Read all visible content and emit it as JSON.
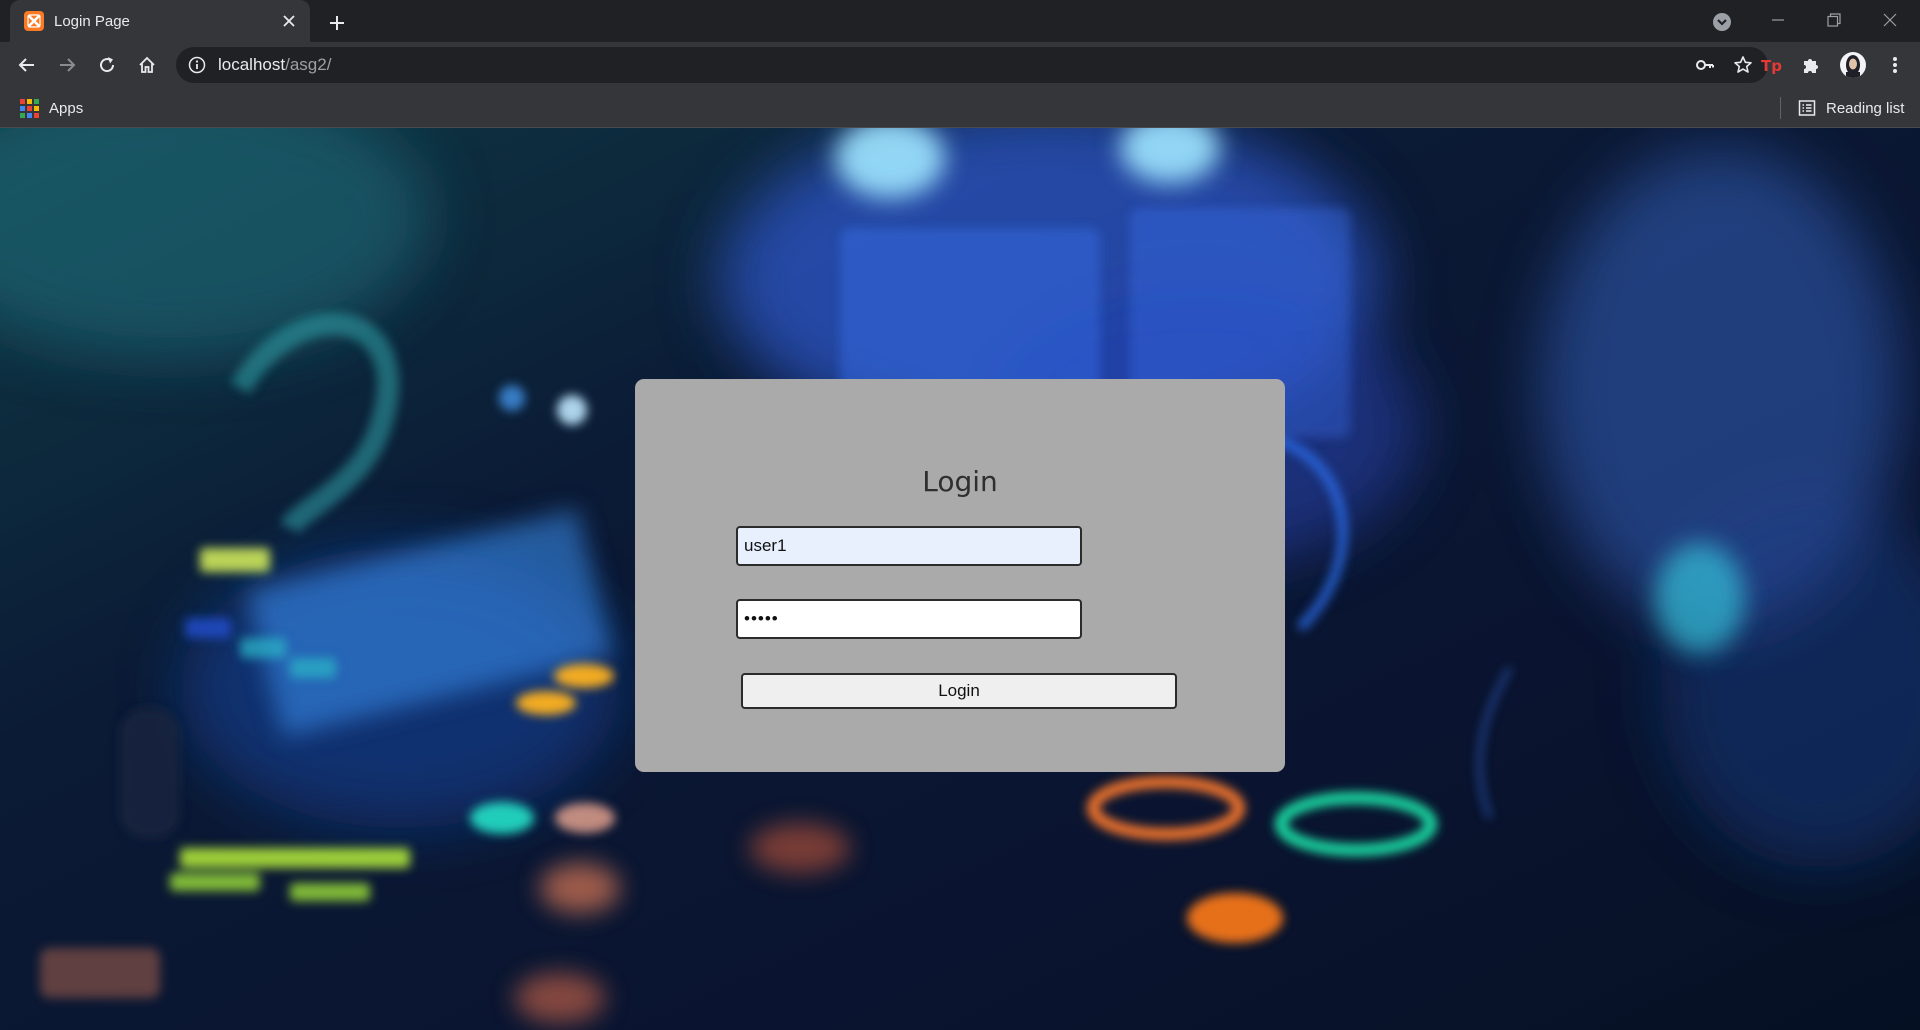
{
  "browser": {
    "tab": {
      "title": "Login Page",
      "favicon": "xampp-favicon"
    },
    "address_bar": {
      "host": "localhost",
      "path": "/asg2/"
    },
    "bookmarks": {
      "apps_label": "Apps",
      "reading_list_label": "Reading list"
    },
    "colors": {
      "frame": "#202124",
      "toolbar": "#35363a",
      "favicon": "#fb7a24"
    }
  },
  "login": {
    "title": "Login",
    "username_value": "user1",
    "password_value": "•••••",
    "button_label": "Login",
    "colors": {
      "card": "#aaaaaa",
      "username_autofill": "#e8f0fe"
    }
  }
}
